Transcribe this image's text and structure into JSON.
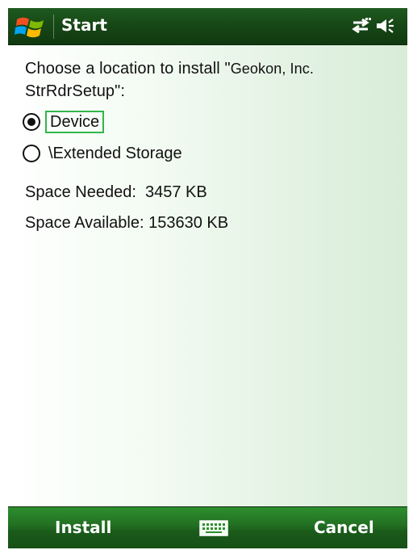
{
  "header": {
    "start_label": "Start",
    "start_icon": "windows-logo-icon",
    "connectivity_icon": "connectivity-icon",
    "volume_icon": "speaker-icon"
  },
  "main": {
    "prompt_lead": "Choose a location to install \"",
    "prompt_app": "Geokon, Inc.",
    "prompt_line2": "StrRdrSetup\":",
    "options": [
      {
        "label": "Device",
        "selected": true
      },
      {
        "label": "\\Extended Storage",
        "selected": false
      }
    ],
    "space_needed": "Space Needed:  3457 KB",
    "space_available": "Space Available: 153630 KB"
  },
  "softkeys": {
    "left_label": "Install",
    "right_label": "Cancel",
    "keyboard_icon": "keyboard-icon"
  },
  "colors": {
    "title_bar": "#174817",
    "softkey_bar": "#226f22",
    "focus_outline": "#32b64b"
  }
}
